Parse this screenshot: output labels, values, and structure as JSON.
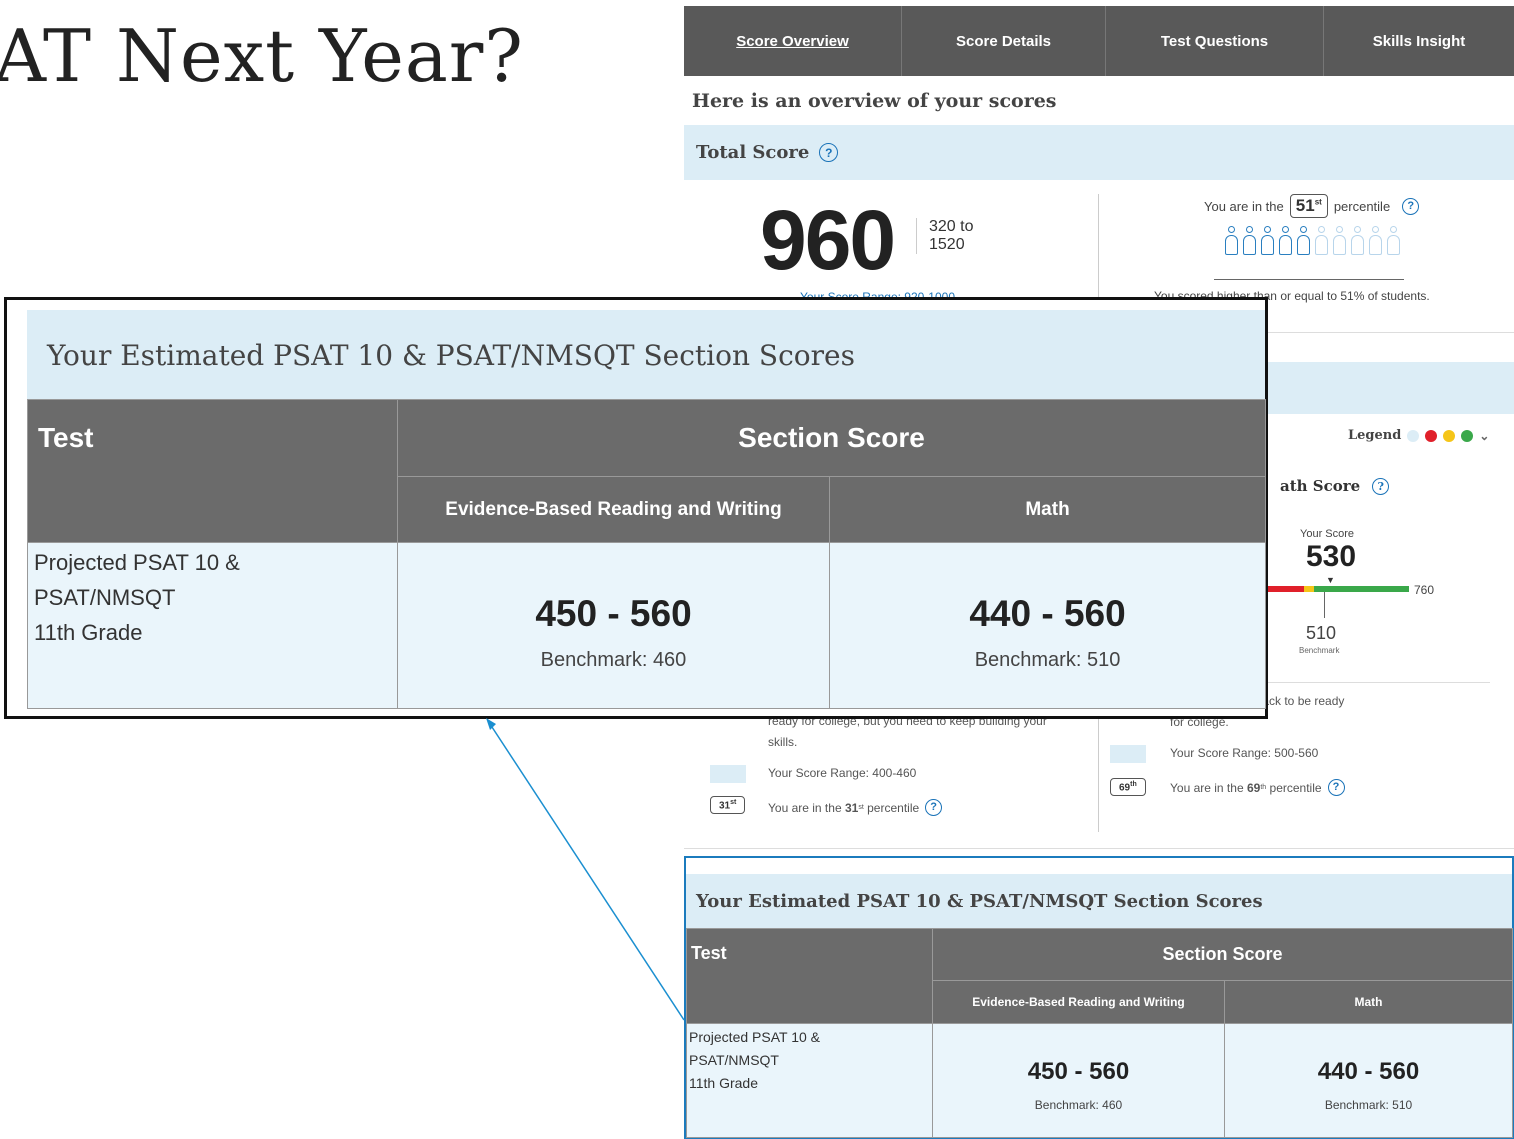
{
  "slide": {
    "title_fragment": "AT Next Year?"
  },
  "tabs": [
    {
      "label": "Score Overview",
      "active": true
    },
    {
      "label": "Score Details",
      "active": false
    },
    {
      "label": "Test Questions",
      "active": false
    },
    {
      "label": "Skills Insight",
      "active": false
    }
  ],
  "overview": {
    "heading": "Here is an overview of your scores",
    "total_score_label": "Total Score",
    "total_score": "960",
    "score_scale_line1": "320 to",
    "score_scale_line2": "1520",
    "score_range_text": "Your Score Range: 920-1000",
    "percentile_prefix": "You are in the",
    "percentile_value": "51",
    "percentile_suffix_sup": "st",
    "percentile_suffix": "percentile",
    "percentile_filled": 5,
    "percentile_total": 10,
    "percentile_caption": "You scored higher than or equal to 51% of students."
  },
  "legend": {
    "label": "Legend",
    "colors": [
      "#dcedf6",
      "#e0202a",
      "#f5c518",
      "#3aa84a"
    ]
  },
  "math": {
    "label": "ath Score",
    "your_score_label": "Your Score",
    "your_score": "530",
    "scale_max": "760",
    "benchmark": "510",
    "benchmark_label": "Benchmark"
  },
  "left_status": {
    "line1": "ready for college, but you need to keep building your",
    "line2": "skills.",
    "range": "Your Score Range: 400-460",
    "pill": "31",
    "pill_sup": "st",
    "pct_prefix": "You are in the",
    "pct_value": "31",
    "pct_sup": "st",
    "pct_suffix": "percentile",
    "status_color": "#f5c518"
  },
  "right_status": {
    "line1": "s that you're on track to be ready",
    "line2": "for college.",
    "range": "Your Score Range: 500-560",
    "pill": "69",
    "pill_sup": "th",
    "pct_prefix": "You are in the",
    "pct_value": "69",
    "pct_sup": "th",
    "pct_suffix": "percentile",
    "status_color": "#3aa84a"
  },
  "section_table": {
    "title": "Your Estimated PSAT 10 & PSAT/NMSQT Section Scores",
    "col_test": "Test",
    "col_section": "Section Score",
    "col_ebrw": "Evidence-Based Reading and Writing",
    "col_math": "Math",
    "row_label_line1": "Projected  PSAT 10 &",
    "row_label_line2": "PSAT/NMSQT",
    "row_label_line3": "11th Grade",
    "ebrw_range": "450 - 560",
    "ebrw_benchmark": "Benchmark: 460",
    "math_range": "440 - 560",
    "math_benchmark": "Benchmark: 510"
  }
}
